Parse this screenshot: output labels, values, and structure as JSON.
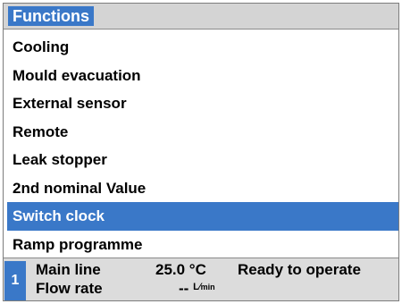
{
  "window": {
    "title": "Functions"
  },
  "menu": {
    "items": [
      {
        "label": "Cooling",
        "selected": false
      },
      {
        "label": "Mould evacuation",
        "selected": false
      },
      {
        "label": "External sensor",
        "selected": false
      },
      {
        "label": "Remote",
        "selected": false
      },
      {
        "label": "Leak stopper",
        "selected": false
      },
      {
        "label": "2nd nominal Value",
        "selected": false
      },
      {
        "label": "Switch clock",
        "selected": true
      },
      {
        "label": "Ramp programme",
        "selected": false
      }
    ]
  },
  "status": {
    "index": "1",
    "main_line_label": "Main line",
    "main_line_value": "25.0 °C",
    "flow_rate_label": "Flow rate",
    "flow_rate_value": "--",
    "flow_rate_unit_num": "L",
    "flow_rate_unit_den": "min",
    "state_text": "Ready to operate"
  },
  "colors": {
    "accent": "#3a78c8",
    "titlebar_bg": "#d4d4d4",
    "statusbar_bg": "#dcdcdc"
  },
  "icons": []
}
